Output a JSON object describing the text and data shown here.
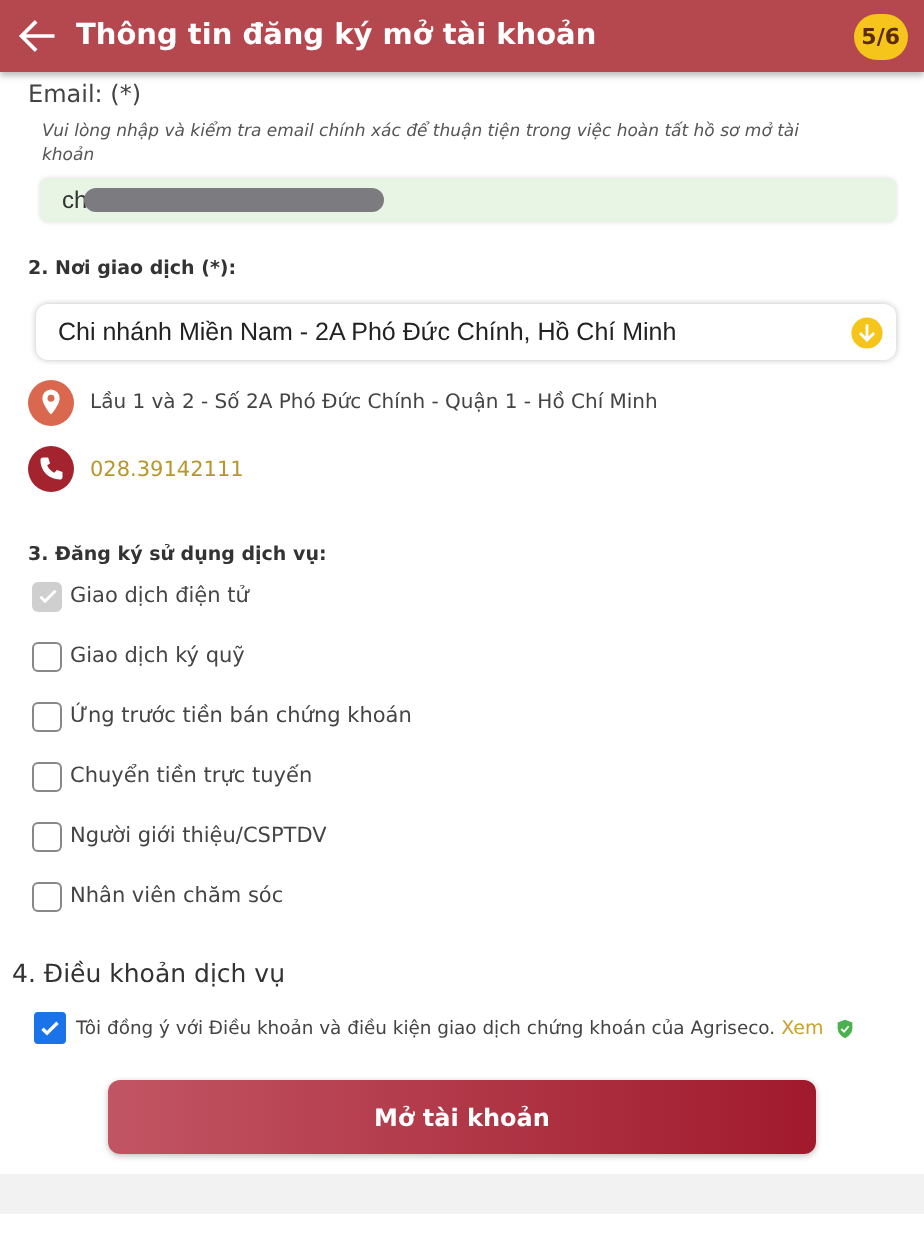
{
  "header": {
    "title": "Thông tin đăng ký mở tài khoản",
    "step": "5/6"
  },
  "email": {
    "label": "Email: (*)",
    "hint": "Vui lòng nhập và kiểm tra email chính xác để thuận tiện trong việc hoàn tất hồ sơ mở tài khoản",
    "value": "ch",
    "redacted": true
  },
  "branch": {
    "label": "2. Nơi giao dịch (*):",
    "value": "Chi nhánh Miền Nam - 2A Phó Đức Chính, Hồ Chí Minh",
    "address": "Lầu 1 và 2 - Số 2A Phó Đức Chính - Quận 1 - Hồ Chí Minh",
    "phone": "028.39142111"
  },
  "services": {
    "label": "3. Đăng ký sử dụng dịch vụ:",
    "items": [
      {
        "label": "Giao dịch điện tử",
        "checked": true,
        "disabled": true
      },
      {
        "label": "Giao dịch ký quỹ",
        "checked": false,
        "disabled": false
      },
      {
        "label": "Ứng trước tiền bán chứng khoán",
        "checked": false,
        "disabled": false
      },
      {
        "label": "Chuyển tiền trực tuyến",
        "checked": false,
        "disabled": false
      },
      {
        "label": "Người giới thiệu/CSPTDV",
        "checked": false,
        "disabled": false
      },
      {
        "label": "Nhân viên chăm sóc",
        "checked": false,
        "disabled": false
      }
    ]
  },
  "terms": {
    "heading": "4. Điều khoản dịch vụ",
    "text": "Tôi đồng ý với Điều khoản và điều kiện giao dịch chứng khoán của Agriseco.",
    "link": "Xem",
    "checked": true
  },
  "submit": "Mở tài khoản"
}
